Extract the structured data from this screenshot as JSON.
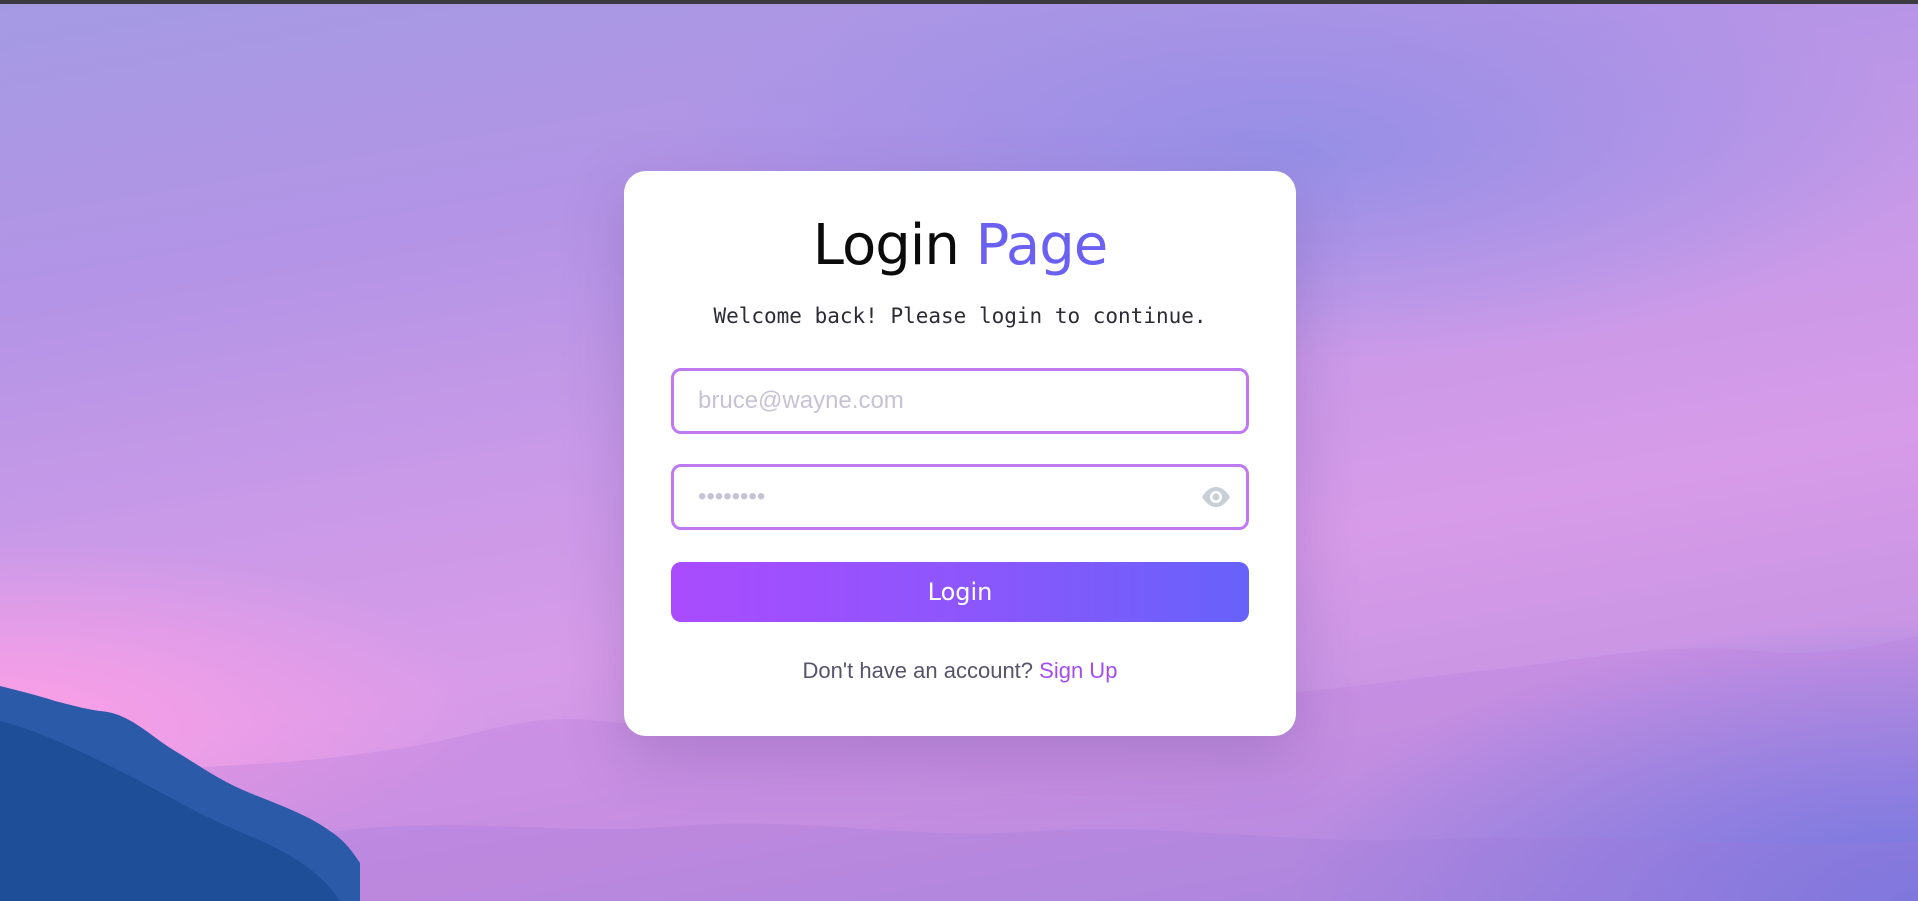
{
  "login": {
    "title_main": "Login",
    "title_accent": "Page",
    "subtitle": "Welcome back! Please login to continue.",
    "email_placeholder": "bruce@wayne.com",
    "password_placeholder": "••••••••",
    "login_button": "Login",
    "signup_prompt": "Don't have an account?",
    "signup_link": "Sign Up",
    "password_toggle_icon": "eye-icon"
  },
  "colors": {
    "accent": "#6a61f4",
    "field_border": "#c07af0",
    "button_gradient_start": "#aa4cfe",
    "button_gradient_end": "#6762fa",
    "link": "#a34ff0"
  }
}
